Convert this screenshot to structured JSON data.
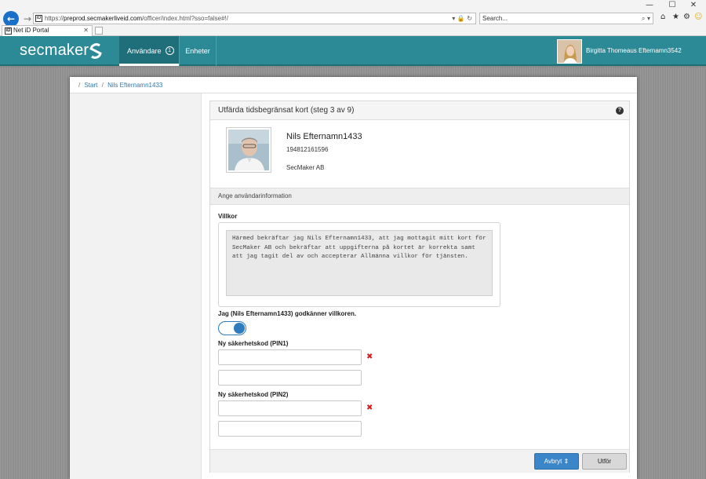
{
  "browser": {
    "url_prefix": "https://",
    "url_host": "preprod.secmakerliveid.com",
    "url_path": "/officer/index.html?sso=false#!/",
    "favicon_text": "iD",
    "search_placeholder": "Search...",
    "tab_title": "Net iD Portal",
    "window_controls": {
      "minimize": "—",
      "maximize": "☐",
      "close": "✕"
    }
  },
  "header": {
    "logo_text": "secmaker",
    "nav": [
      {
        "label": "Användare",
        "badge": "1"
      },
      {
        "label": "Enheter"
      }
    ],
    "user_name": "Birgitta Thomeaus Efternamn3542"
  },
  "breadcrumb": [
    "Start",
    "Nils Efternamn1433"
  ],
  "wizard": {
    "title": "Utfärda tidsbegränsat kort (steg 3 av 9)",
    "help_glyph": "?",
    "person": {
      "name": "Nils Efternamn1433",
      "personal_number": "194812161596",
      "organization": "SecMaker AB"
    },
    "section_title": "Ange användarinformation",
    "terms_label": "Villkor",
    "terms_text": "Härmed bekräftar jag Nils Efternamn1433, att jag mottagit mitt kort för SecMaker AB och bekräftar att uppgifterna på kortet är korrekta samt att jag tagit del av och accepterar Allmänna villkor för tjänsten.",
    "accept_label": "Jag (Nils Efternamn1433) godkänner villkoren.",
    "accept_on": true,
    "pin1_label": "Ny säkerhetskod (PIN1)",
    "pin2_label": "Ny säkerhetskod (PIN2)",
    "pin1_value": "",
    "pin1_confirm_value": "",
    "pin2_value": "",
    "pin2_confirm_value": "",
    "invalid_mark": "✖",
    "cancel_label": "Avbryt ⇕",
    "execute_label": "Utför"
  },
  "colors": {
    "appbar": "#2b8a96",
    "accent": "#3b86c8",
    "error": "#d02020"
  }
}
